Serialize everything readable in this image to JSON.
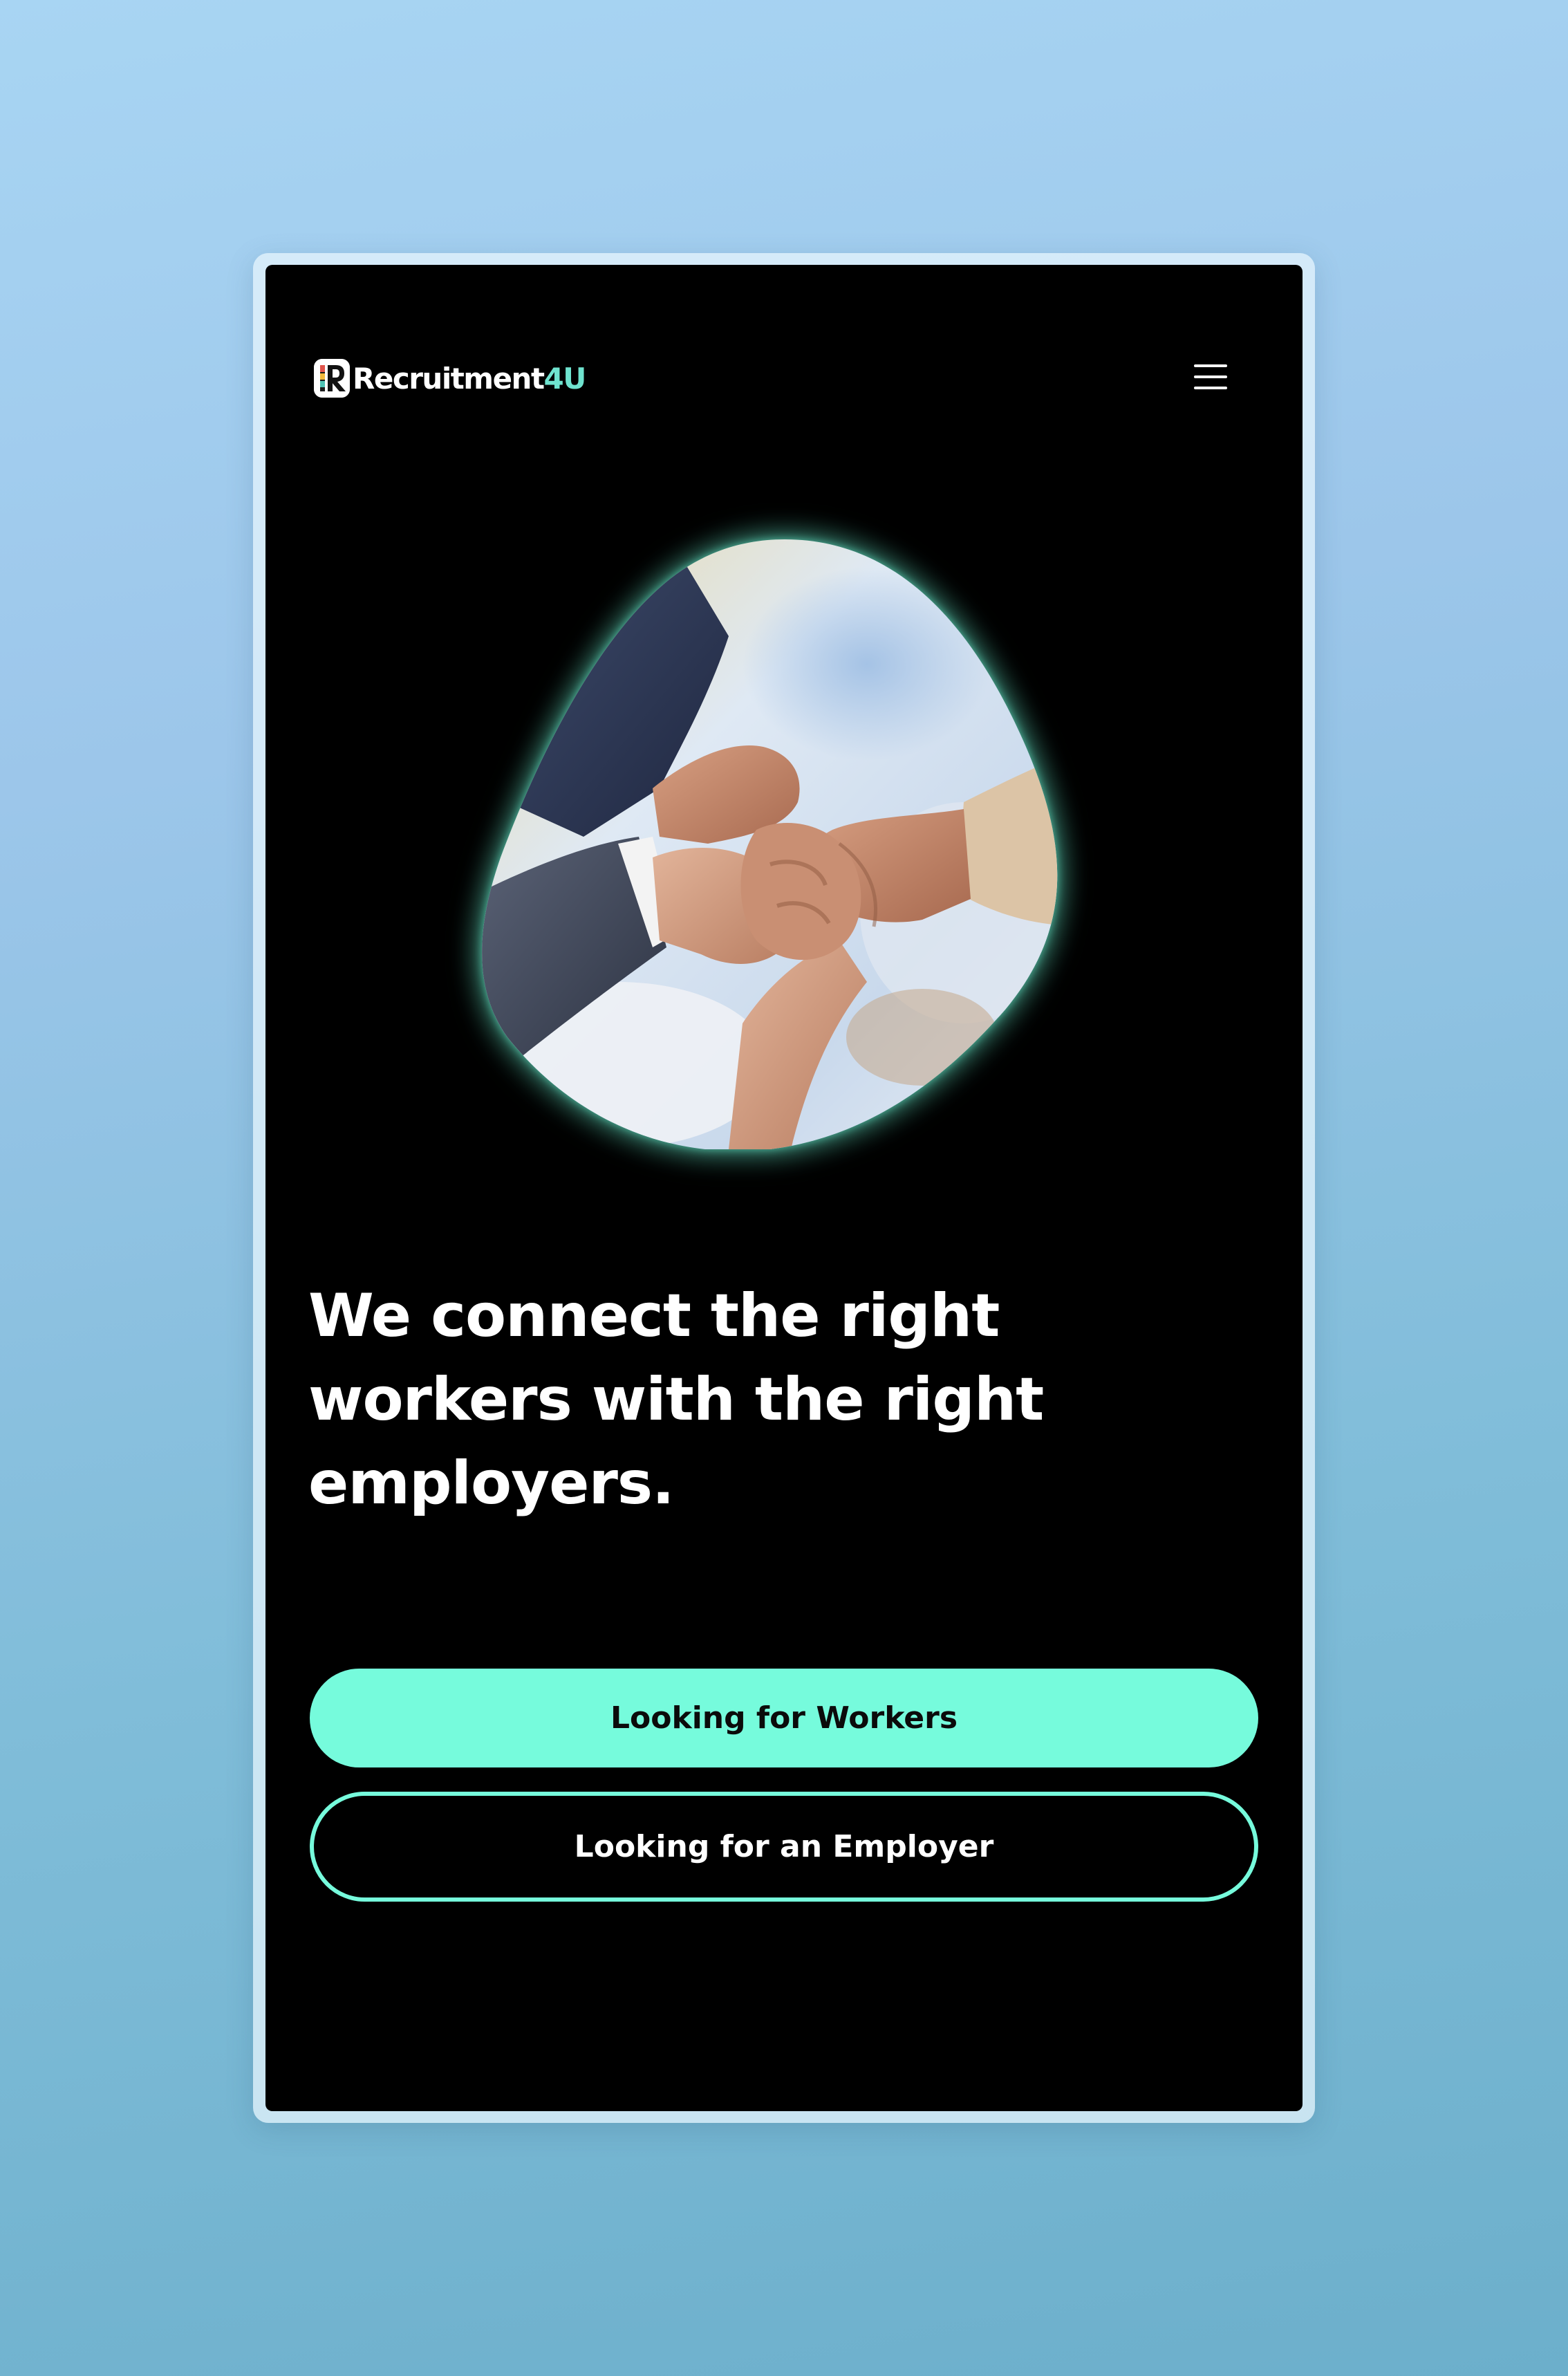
{
  "header": {
    "logo_text": "Recruitment",
    "logo_accent": "4U",
    "logo_mark_letter": "R",
    "menu_icon": "hamburger-menu-icon"
  },
  "hero": {
    "image_subject": "Four hands gripping each other's wrists in a team unity gesture above an office desk",
    "headline": "We connect the right workers with the right employers."
  },
  "actions": {
    "workers_label": "Looking for Workers",
    "employer_label": "Looking for an Employer"
  },
  "colors": {
    "accent": "#76fbdc",
    "screen_background": "#000000",
    "text": "#ffffff"
  }
}
